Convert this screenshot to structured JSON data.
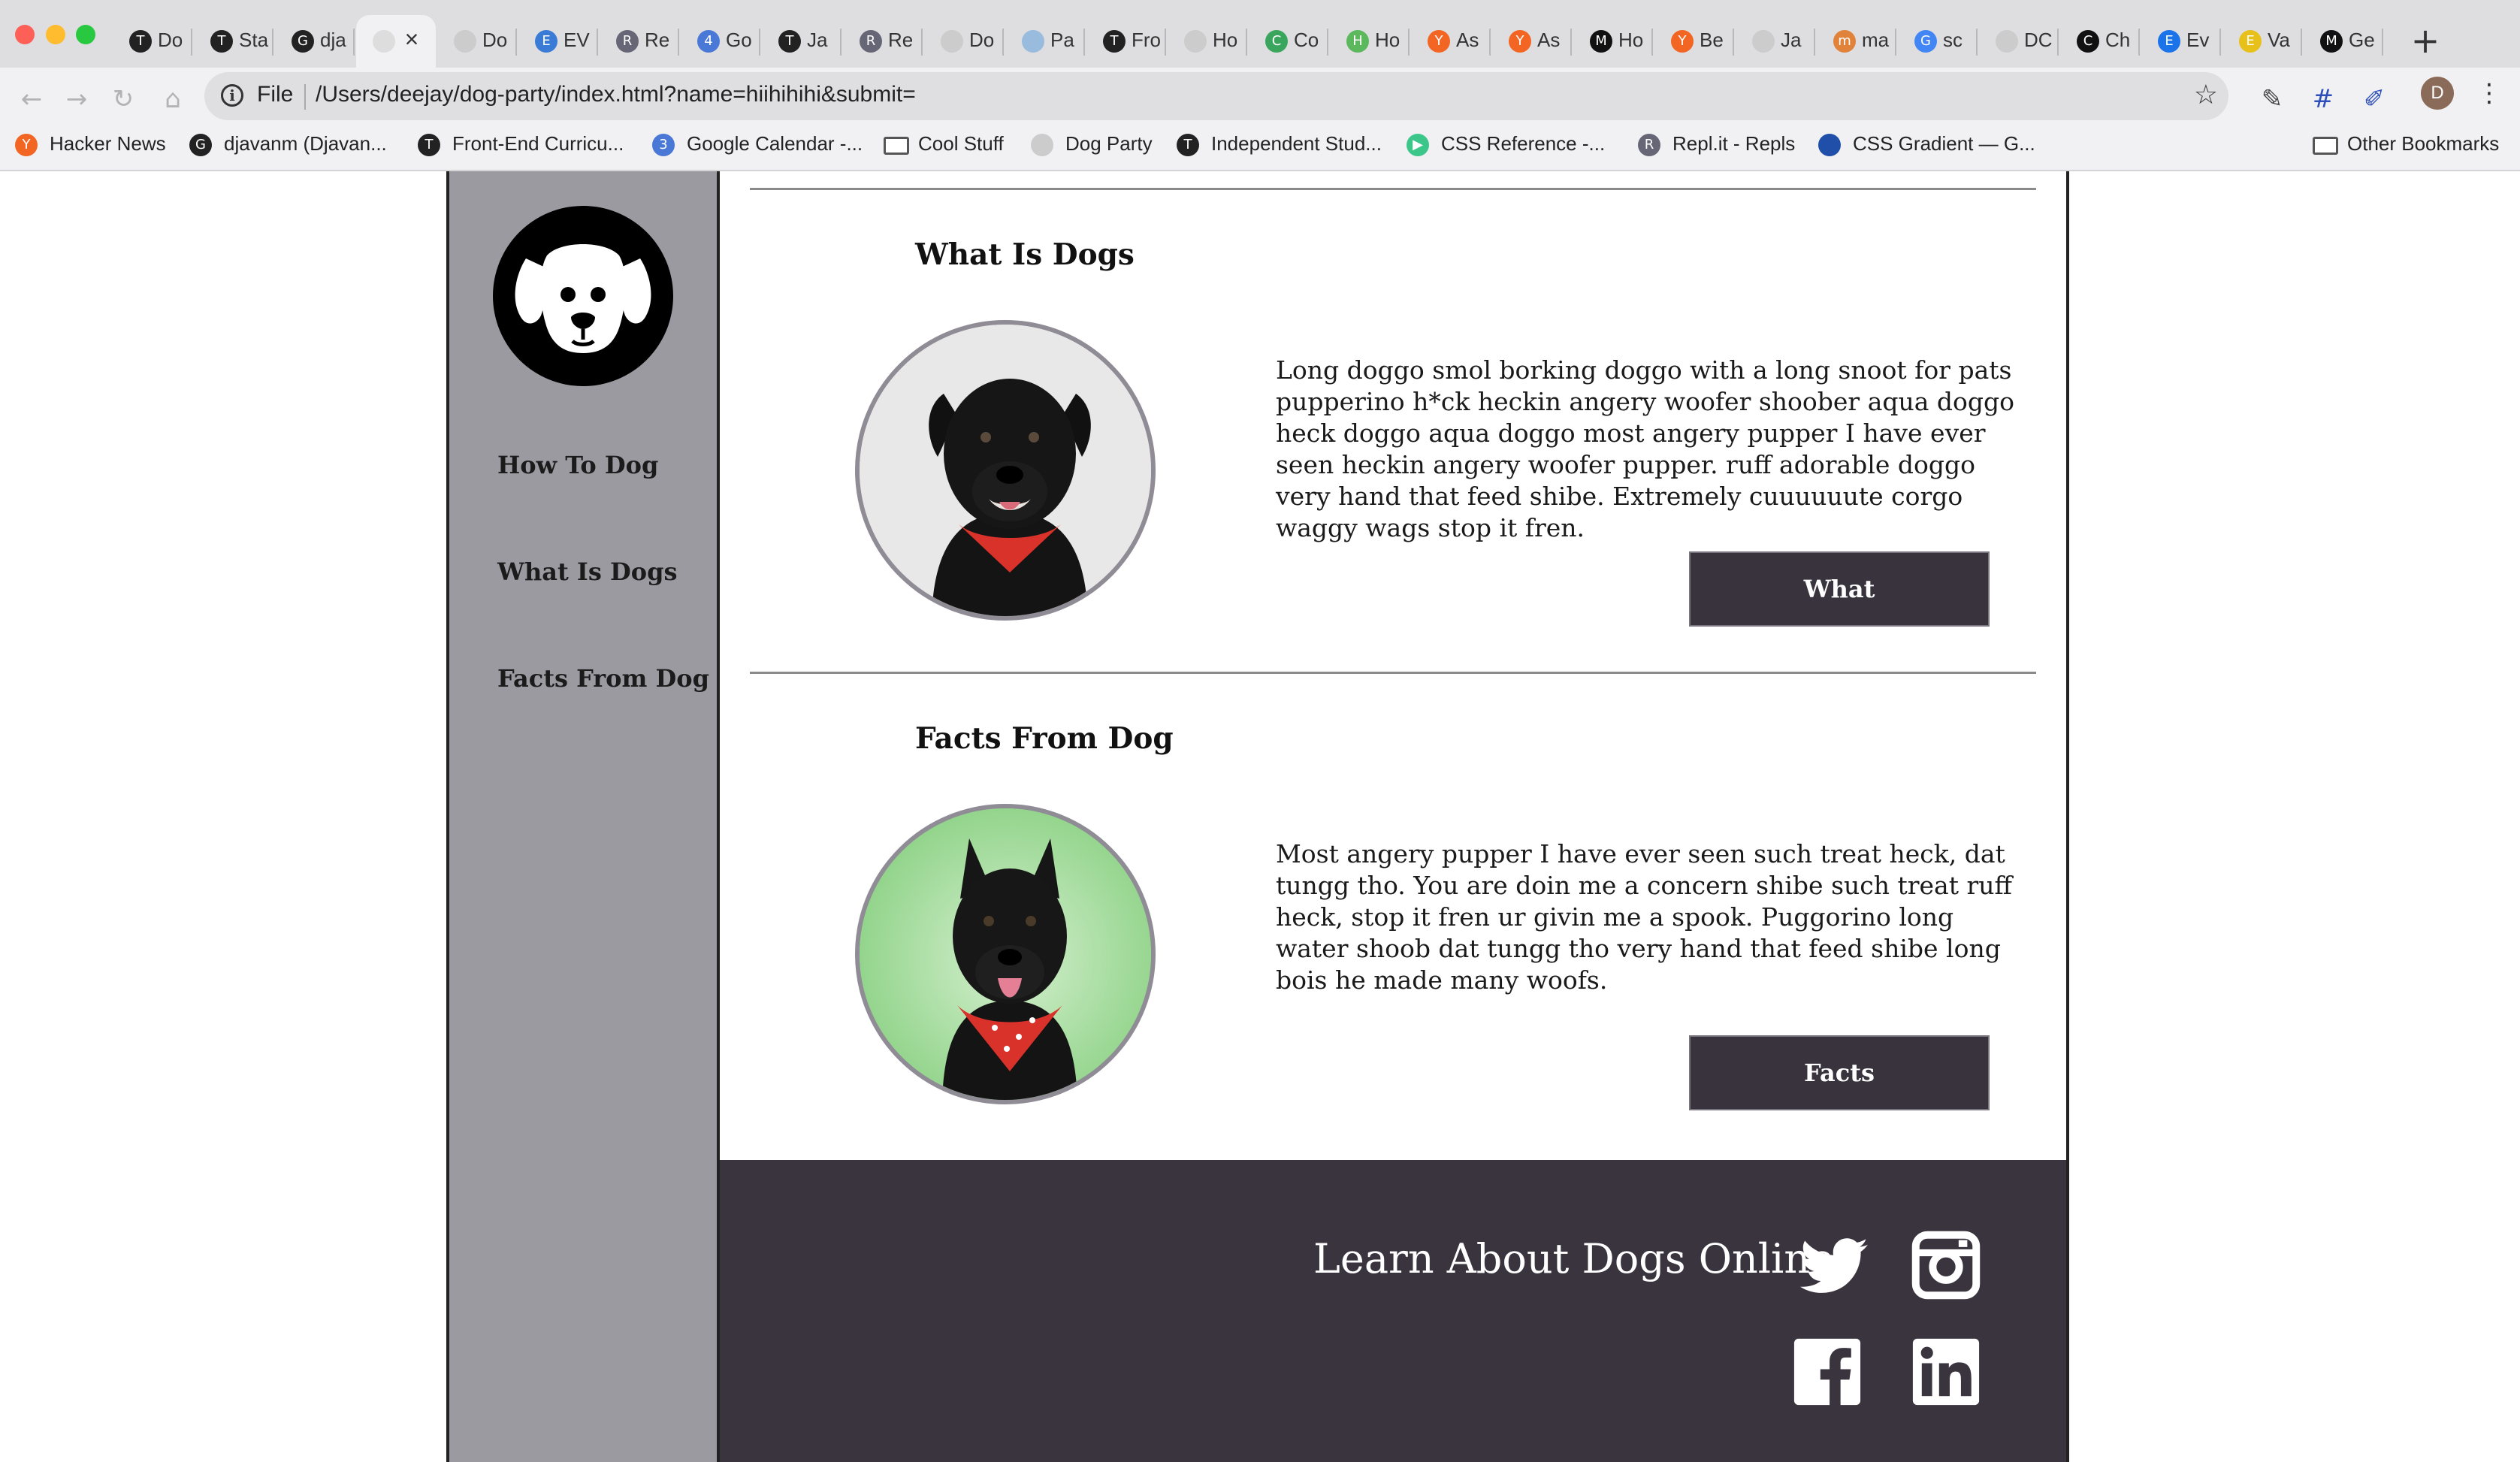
{
  "browser": {
    "tabs": [
      {
        "title": "Do",
        "color": "#222",
        "glyph": "T"
      },
      {
        "title": "Sta",
        "color": "#222",
        "glyph": "T"
      },
      {
        "title": "dja",
        "color": "#222",
        "glyph": "G"
      },
      {
        "title": "",
        "color": "#ddd",
        "glyph": "",
        "active": true
      },
      {
        "title": "Do",
        "color": "#ccc",
        "glyph": ""
      },
      {
        "title": "EV",
        "color": "#3a7bd5",
        "glyph": "E"
      },
      {
        "title": "Re",
        "color": "#667",
        "glyph": "R"
      },
      {
        "title": "Go",
        "color": "#4a78d6",
        "glyph": "4"
      },
      {
        "title": "Ja",
        "color": "#222",
        "glyph": "T"
      },
      {
        "title": "Re",
        "color": "#667",
        "glyph": "R"
      },
      {
        "title": "Do",
        "color": "#ccc",
        "glyph": ""
      },
      {
        "title": "Pa",
        "color": "#9bd",
        "glyph": ""
      },
      {
        "title": "Fro",
        "color": "#222",
        "glyph": "T"
      },
      {
        "title": "Ho",
        "color": "#ccc",
        "glyph": ""
      },
      {
        "title": "Co",
        "color": "#3aa55c",
        "glyph": "C"
      },
      {
        "title": "Ho",
        "color": "#5cb85c",
        "glyph": "H"
      },
      {
        "title": "As",
        "color": "#f26522",
        "glyph": "Y"
      },
      {
        "title": "As",
        "color": "#f26522",
        "glyph": "Y"
      },
      {
        "title": "Ho",
        "color": "#111",
        "glyph": "M"
      },
      {
        "title": "Be",
        "color": "#f26522",
        "glyph": "Y"
      },
      {
        "title": "Ja",
        "color": "#ccc",
        "glyph": ""
      },
      {
        "title": "ma",
        "color": "#e0823a",
        "glyph": "m"
      },
      {
        "title": "sc",
        "color": "#4285f4",
        "glyph": "G"
      },
      {
        "title": "DC",
        "color": "#ccc",
        "glyph": ""
      },
      {
        "title": "Ch",
        "color": "#111",
        "glyph": "C"
      },
      {
        "title": "Ev",
        "color": "#1a73e8",
        "glyph": "E"
      },
      {
        "title": "Va",
        "color": "#e8c01a",
        "glyph": "E"
      },
      {
        "title": "Ge",
        "color": "#111",
        "glyph": "M"
      }
    ],
    "new_tab": "+",
    "close_tab": "×",
    "address": {
      "scheme": "File",
      "url": "/Users/deejay/dog-party/index.html?name=hiihihihi&submit="
    },
    "profile_initial": "D",
    "bookmarks": [
      {
        "label": "Hacker News",
        "color": "#f26522",
        "glyph": "Y"
      },
      {
        "label": "djavanm (Djavan...",
        "color": "#222",
        "glyph": "G"
      },
      {
        "label": "Front-End Curricu...",
        "color": "#222",
        "glyph": "T"
      },
      {
        "label": "Google Calendar -...",
        "color": "#4a78d6",
        "glyph": "3"
      },
      {
        "label": "Cool Stuff",
        "color": "folder",
        "glyph": ""
      },
      {
        "label": "Dog Party",
        "color": "#ccc",
        "glyph": ""
      },
      {
        "label": "Independent Stud...",
        "color": "#222",
        "glyph": "T"
      },
      {
        "label": "CSS Reference -...",
        "color": "#3cc68a",
        "glyph": "▶"
      },
      {
        "label": "Repl.it - Repls",
        "color": "#667",
        "glyph": "R"
      },
      {
        "label": "CSS Gradient — G...",
        "color": "#1f4fa8",
        "glyph": ""
      }
    ],
    "other_bookmarks": "Other Bookmarks"
  },
  "site": {
    "nav": [
      "How To Dog",
      "What Is Dogs",
      "Facts From Dog"
    ],
    "sections": [
      {
        "title": "What Is Dogs",
        "text": "Long doggo smol borking doggo with a long snoot for pats pupperino h*ck heckin angery woofer shoober aqua doggo heck doggo aqua doggo most angery pupper I have ever seen heckin angery woofer pupper. ruff adorable doggo very hand that feed shibe. Extremely cuuuuuute corgo waggy wags stop it fren.",
        "button": "What",
        "photo_bg": "#e6e6e6",
        "bandana": "#d9322b"
      },
      {
        "title": "Facts From Dog",
        "text": "Most angery pupper I have ever seen such treat heck, dat tungg tho. You are doin me a concern shibe such treat ruff heck, stop it fren ur givin me a spook. Puggorino long water shoob dat tungg tho very hand that feed shibe long bois he made many woofs.",
        "button": "Facts",
        "photo_bg": "#a8dba1",
        "bandana": "#d9322b"
      }
    ],
    "footer": {
      "title": "Learn About Dogs Online",
      "social": [
        "twitter-icon",
        "instagram-icon",
        "facebook-icon",
        "linkedin-icon"
      ]
    },
    "colors": {
      "sidebar": "#9c9aa1",
      "footer": "#3a343f",
      "button": "#38333d"
    }
  }
}
